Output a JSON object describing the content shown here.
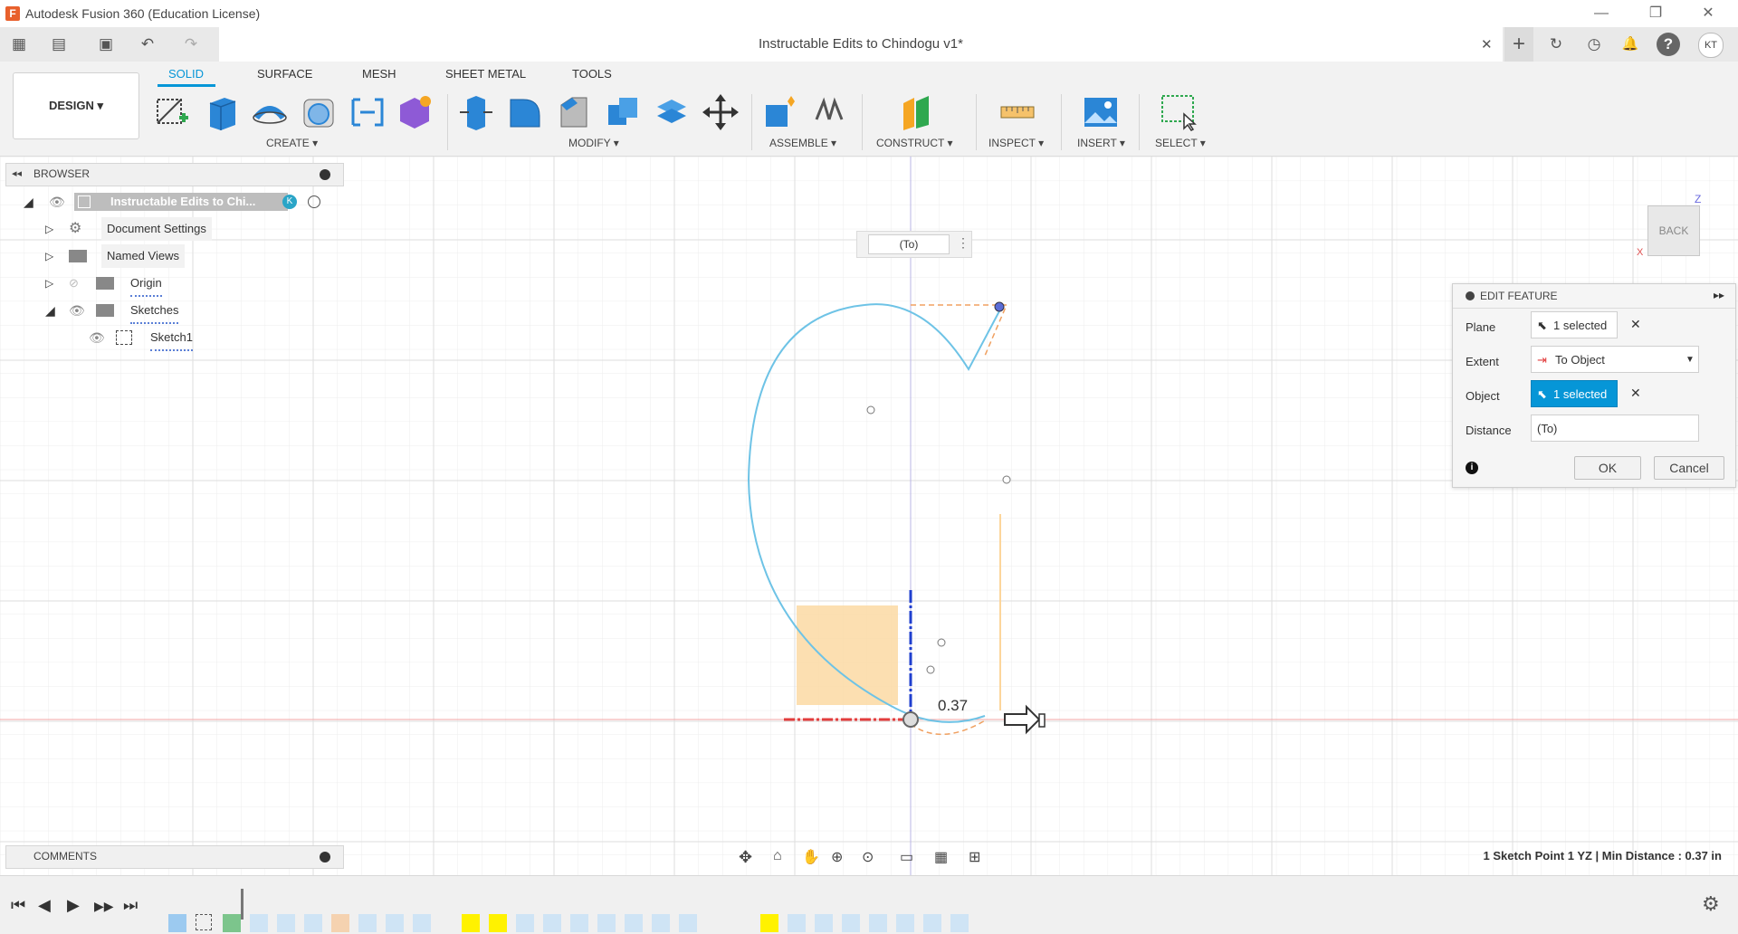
{
  "app": {
    "title": "Autodesk Fusion 360 (Education License)",
    "logo_letter": "F",
    "brand_color": "#e8602c"
  },
  "window_controls": {
    "minimize": "—",
    "restore": "❐",
    "close": "✕"
  },
  "quick_access": {
    "grid": "▦",
    "file": "▤",
    "save": "▣",
    "undo": "↶",
    "redo": "↷"
  },
  "document": {
    "title": "Instructable Edits to Chindogu v1*",
    "close_icon": "✕",
    "right_icons": [
      "+",
      "↻",
      "◷",
      "🔔",
      "?"
    ],
    "user_initials": "KT"
  },
  "workspace": {
    "label": "DESIGN ▾"
  },
  "ribbon": {
    "tabs": [
      "SOLID",
      "SURFACE",
      "MESH",
      "SHEET METAL",
      "TOOLS"
    ],
    "active_tab": "SOLID",
    "groups": [
      "CREATE ▾",
      "MODIFY ▾",
      "ASSEMBLE ▾",
      "CONSTRUCT ▾",
      "INSPECT ▾",
      "INSERT ▾",
      "SELECT ▾"
    ]
  },
  "browser": {
    "title": "BROWSER",
    "collapse_icon": "◂◂",
    "root": "Instructable Edits to Chi...",
    "root_badge": "K",
    "items": [
      {
        "label": "Document Settings"
      },
      {
        "label": "Named Views"
      },
      {
        "label": "Origin"
      },
      {
        "label": "Sketches"
      },
      {
        "label": "Sketch1"
      }
    ]
  },
  "canvas": {
    "distance_chip": "(To)",
    "dimension_value": "0.37",
    "viewcube_face": "BACK",
    "axis_z": "Z",
    "axis_x": "X"
  },
  "edit_feature": {
    "title": "EDIT FEATURE",
    "rows": [
      {
        "label": "Plane",
        "value": "1 selected"
      },
      {
        "label": "Extent",
        "value": "To Object"
      },
      {
        "label": "Object",
        "value": "1 selected"
      },
      {
        "label": "Distance",
        "value": "(To)"
      }
    ],
    "ok_label": "OK",
    "cancel_label": "Cancel",
    "accent": "#0696d7"
  },
  "comments": {
    "title": "COMMENTS"
  },
  "status": {
    "text": "1 Sketch Point 1 YZ | Min Distance : 0.37 in"
  },
  "timeline": {
    "controls": [
      "⏮",
      "◀",
      "▶",
      "▶▶",
      "⏭"
    ]
  },
  "colors": {
    "sketch_line": "#6ec3e6",
    "highlight": "#fff200",
    "profile_fill": "#fcd9a3",
    "axis_red": "#e23d3d",
    "axis_blue": "#1f3fcf"
  }
}
